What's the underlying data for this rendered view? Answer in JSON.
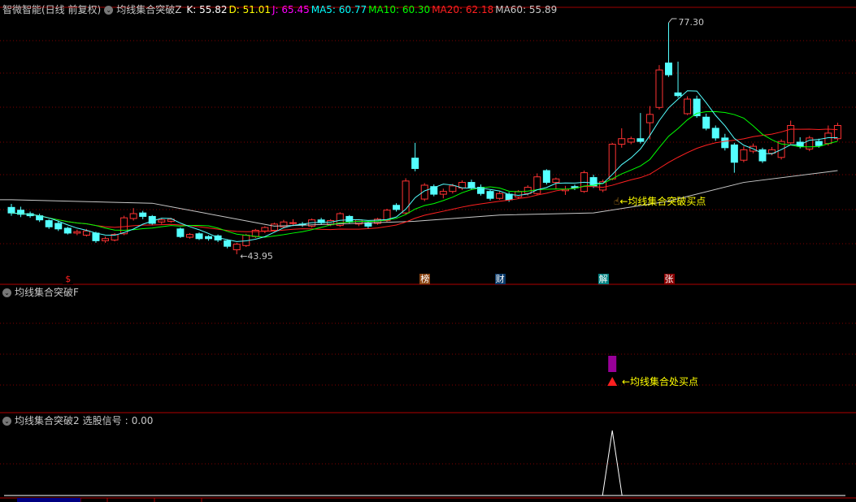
{
  "header": {
    "stock_name": "智微智能(日线 前复权)",
    "indicator_name": "均线集合突破Z",
    "values": [
      {
        "label": "K",
        "value": "55.82",
        "color": "#ffffff"
      },
      {
        "label": "D",
        "value": "51.01",
        "color": "#ffff00"
      },
      {
        "label": "J",
        "value": "65.45",
        "color": "#ff00ff"
      },
      {
        "label": "MA5",
        "value": "60.77",
        "color": "#00ffff"
      },
      {
        "label": "MA10",
        "value": "60.30",
        "color": "#00ff00"
      },
      {
        "label": "MA20",
        "value": "62.18",
        "color": "#ff2020"
      },
      {
        "label": "MA60",
        "value": "55.89",
        "color": "#c8c8c8"
      }
    ]
  },
  "main": {
    "high_label": "77.30",
    "low_label": "←43.95",
    "buy_annotation": "←均线集合突破买点",
    "markers": [
      {
        "text": "$",
        "candle": 6,
        "bg": "#000000",
        "color": "#ff2020"
      },
      {
        "text": "榜",
        "candle": 44,
        "bg": "#8b4513",
        "color": "#ffffff"
      },
      {
        "text": "财",
        "candle": 52,
        "bg": "#0a3a6a",
        "color": "#ffffff"
      },
      {
        "text": "解",
        "candle": 63,
        "bg": "#008080",
        "color": "#ffffff"
      },
      {
        "text": "张",
        "candle": 70,
        "bg": "#8b0000",
        "color": "#ffffff"
      }
    ]
  },
  "pane2": {
    "title": "均线集合突破F",
    "annotation": "←均线集合处买点",
    "signal_candle": 64
  },
  "pane3": {
    "title": "均线集合突破2",
    "signal_label": "选股信号",
    "signal_value": "0.00",
    "signal_candle": 64
  },
  "colors": {
    "up": "#ff3232",
    "down": "#54ffff",
    "ma5": "#ffffff",
    "ma10": "#00ff00",
    "ma20": "#ff2020",
    "ma60": "#c8c8c8",
    "grid": "#800000"
  },
  "chart_data": {
    "type": "candlestick",
    "price_range": [
      43.95,
      77.3
    ],
    "candles": [
      [
        50.7,
        49.9,
        51.2,
        49.5
      ],
      [
        50.3,
        49.7,
        50.8,
        49.3
      ],
      [
        49.8,
        49.5,
        50.1,
        49.2
      ],
      [
        49.5,
        48.9,
        49.8,
        48.6
      ],
      [
        48.8,
        47.9,
        49.0,
        47.6
      ],
      [
        48.4,
        47.6,
        48.8,
        47.3
      ],
      [
        47.7,
        47.0,
        47.9,
        46.8
      ],
      [
        47.0,
        47.2,
        47.5,
        46.7
      ],
      [
        46.7,
        47.3,
        47.6,
        46.5
      ],
      [
        47.0,
        45.9,
        47.2,
        45.6
      ],
      [
        45.9,
        46.2,
        46.5,
        45.6
      ],
      [
        46.0,
        46.8,
        47.0,
        45.8
      ],
      [
        46.9,
        49.2,
        49.5,
        46.7
      ],
      [
        49.1,
        49.8,
        50.6,
        48.8
      ],
      [
        49.9,
        49.4,
        50.2,
        49.0
      ],
      [
        49.4,
        48.4,
        49.6,
        48.1
      ],
      [
        48.6,
        48.9,
        49.1,
        48.3
      ],
      [
        48.7,
        49.0,
        49.2,
        48.5
      ],
      [
        47.6,
        46.5,
        47.8,
        46.3
      ],
      [
        46.4,
        46.8,
        47.0,
        46.2
      ],
      [
        46.9,
        46.2,
        47.1,
        46.0
      ],
      [
        46.5,
        46.2,
        46.7,
        45.9
      ],
      [
        46.6,
        46.0,
        46.8,
        45.7
      ],
      [
        45.9,
        45.1,
        46.1,
        44.8
      ],
      [
        44.6,
        45.4,
        45.6,
        43.95
      ],
      [
        45.2,
        46.7,
        46.9,
        45.0
      ],
      [
        46.5,
        47.4,
        47.6,
        46.3
      ],
      [
        47.3,
        47.8,
        48.0,
        47.0
      ],
      [
        47.4,
        48.3,
        48.5,
        47.2
      ],
      [
        47.9,
        48.6,
        48.9,
        47.7
      ],
      [
        48.4,
        48.5,
        49.0,
        48.0
      ],
      [
        48.3,
        48.2,
        48.6,
        47.9
      ],
      [
        48.0,
        48.9,
        49.1,
        47.8
      ],
      [
        48.9,
        48.5,
        49.2,
        48.2
      ],
      [
        48.2,
        48.8,
        49.0,
        48.0
      ],
      [
        48.1,
        49.8,
        50.0,
        47.9
      ],
      [
        49.4,
        48.6,
        49.6,
        48.4
      ],
      [
        48.3,
        48.9,
        49.0,
        48.0
      ],
      [
        48.5,
        48.0,
        48.7,
        47.6
      ],
      [
        48.4,
        49.0,
        49.2,
        48.2
      ],
      [
        48.8,
        50.3,
        50.5,
        48.6
      ],
      [
        51.0,
        50.4,
        51.3,
        50.1
      ],
      [
        49.9,
        54.5,
        54.9,
        49.7
      ],
      [
        57.8,
        56.3,
        60.0,
        55.9
      ],
      [
        51.9,
        53.9,
        54.2,
        51.6
      ],
      [
        53.7,
        52.6,
        54.0,
        52.3
      ],
      [
        52.6,
        53.0,
        53.4,
        52.0
      ],
      [
        53.0,
        53.8,
        54.1,
        52.7
      ],
      [
        53.5,
        54.3,
        54.6,
        53.2
      ],
      [
        54.3,
        53.6,
        54.7,
        53.3
      ],
      [
        53.6,
        52.7,
        54.0,
        52.4
      ],
      [
        53.0,
        52.0,
        53.2,
        51.7
      ],
      [
        52.0,
        52.7,
        53.0,
        51.8
      ],
      [
        52.6,
        51.8,
        52.9,
        51.5
      ],
      [
        52.2,
        53.0,
        53.2,
        51.9
      ],
      [
        52.7,
        53.6,
        53.9,
        52.4
      ],
      [
        52.7,
        55.1,
        55.6,
        52.5
      ],
      [
        56.0,
        54.3,
        56.2,
        54.0
      ],
      [
        54.3,
        54.8,
        55.0,
        53.4
      ],
      [
        53.1,
        53.3,
        53.8,
        52.5
      ],
      [
        53.7,
        53.5,
        54.0,
        53.2
      ],
      [
        53.0,
        55.7,
        56.0,
        52.8
      ],
      [
        55.0,
        53.8,
        55.4,
        53.5
      ],
      [
        53.2,
        54.4,
        54.7,
        52.9
      ],
      [
        54.8,
        59.8,
        60.0,
        54.6
      ],
      [
        59.8,
        60.6,
        62.1,
        59.3
      ],
      [
        60.1,
        60.6,
        60.9,
        59.8
      ],
      [
        60.6,
        60.2,
        64.3,
        59.9
      ],
      [
        62.9,
        64.1,
        65.3,
        60.5
      ],
      [
        65.1,
        70.5,
        71.2,
        64.8
      ],
      [
        71.5,
        69.8,
        77.3,
        69.5
      ],
      [
        67.2,
        66.8,
        71.7,
        66.5
      ],
      [
        64.2,
        66.3,
        66.7,
        64.0
      ],
      [
        66.3,
        63.9,
        66.8,
        63.6
      ],
      [
        63.7,
        62.1,
        64.2,
        61.8
      ],
      [
        62.1,
        60.7,
        62.5,
        60.3
      ],
      [
        60.7,
        59.3,
        61.3,
        58.9
      ],
      [
        59.7,
        57.2,
        60.0,
        55.7
      ],
      [
        57.5,
        59.0,
        59.5,
        57.2
      ],
      [
        58.8,
        59.5,
        59.9,
        58.5
      ],
      [
        59.0,
        57.4,
        59.3,
        57.1
      ],
      [
        58.5,
        59.0,
        59.4,
        58.2
      ],
      [
        57.9,
        60.2,
        60.5,
        57.6
      ],
      [
        60.0,
        62.5,
        63.2,
        59.8
      ],
      [
        60.1,
        59.5,
        60.8,
        59.2
      ],
      [
        59.1,
        60.7,
        61.0,
        58.8
      ],
      [
        60.2,
        59.6,
        60.6,
        59.3
      ],
      [
        59.9,
        61.4,
        62.5,
        59.6
      ],
      [
        60.6,
        62.5,
        62.9,
        60.3
      ]
    ],
    "ma60_points": [
      [
        0,
        51.8
      ],
      [
        15,
        51.3
      ],
      [
        28,
        48.0
      ],
      [
        43,
        48.7
      ],
      [
        52,
        49.6
      ],
      [
        62,
        49.9
      ],
      [
        70,
        51.6
      ],
      [
        78,
        54.3
      ],
      [
        88,
        56.0
      ]
    ]
  }
}
